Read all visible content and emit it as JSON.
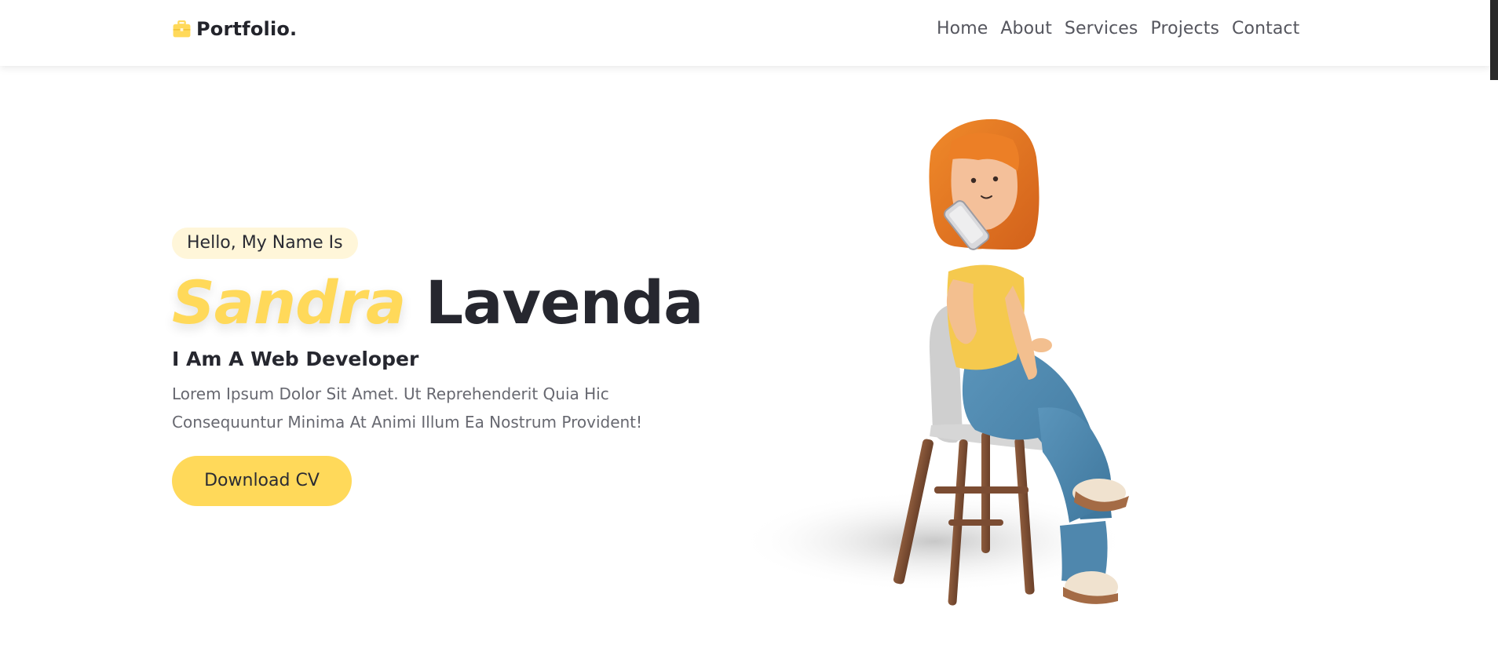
{
  "nav": {
    "logo_text": "Portfolio.",
    "logo_icon": "briefcase-icon",
    "links": [
      {
        "label": "Home"
      },
      {
        "label": "About"
      },
      {
        "label": "Services"
      },
      {
        "label": "Projects"
      },
      {
        "label": "Contact"
      }
    ]
  },
  "hero": {
    "greeting": "Hello, My Name Is",
    "first_name": "Sandra",
    "last_name": "Lavenda",
    "role": "I Am A Web Developer",
    "description": "Lorem Ipsum Dolor Sit Amet. Ut Reprehenderit Quia Hic Consequuntur Minima At Animi Illum Ea Nostrum Provident!",
    "cta_label": "Download CV"
  },
  "colors": {
    "accent": "#ffd95a",
    "accent_light": "#fff6d9",
    "text_dark": "#26272f",
    "text_muted": "#676870"
  }
}
